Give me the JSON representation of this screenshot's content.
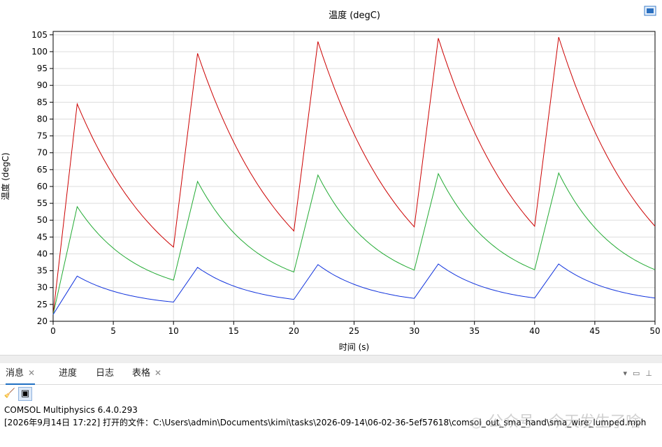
{
  "plot": {
    "title": "温度 (degC)",
    "toolbar_icon": "export-image-icon"
  },
  "chart_data": {
    "type": "line",
    "title": "温度 (degC)",
    "xlabel": "时间 (s)",
    "ylabel": "温度 (degC)",
    "xlim": [
      0,
      50
    ],
    "ylim": [
      20,
      106
    ],
    "x_ticks": [
      0,
      5,
      10,
      15,
      20,
      25,
      30,
      35,
      40,
      45,
      50
    ],
    "y_ticks": [
      20,
      25,
      30,
      35,
      40,
      45,
      50,
      55,
      60,
      65,
      70,
      75,
      80,
      85,
      90,
      95,
      100,
      105
    ],
    "grid": true,
    "legend": "none",
    "series": [
      {
        "color": "#cc0000",
        "points": [
          [
            0,
            22
          ],
          [
            2,
            84.5
          ],
          [
            10,
            42
          ],
          [
            12,
            99.5
          ],
          [
            20,
            46.8
          ],
          [
            22,
            103
          ],
          [
            30,
            48
          ],
          [
            32,
            104
          ],
          [
            40,
            48.2
          ],
          [
            42,
            104.3
          ],
          [
            50,
            48.2
          ]
        ],
        "decay_rate": 0.13
      },
      {
        "color": "#22aa33",
        "points": [
          [
            0,
            22
          ],
          [
            2,
            54
          ],
          [
            10,
            32.2
          ],
          [
            12,
            61.5
          ],
          [
            20,
            34.6
          ],
          [
            22,
            63.4
          ],
          [
            30,
            35.2
          ],
          [
            32,
            63.8
          ],
          [
            40,
            35.3
          ],
          [
            42,
            64
          ],
          [
            50,
            35.3
          ]
        ],
        "decay_rate": 0.2
      },
      {
        "color": "#1133dd",
        "points": [
          [
            0,
            22
          ],
          [
            2,
            33.4
          ],
          [
            10,
            25.7
          ],
          [
            12,
            36
          ],
          [
            20,
            26.5
          ],
          [
            22,
            36.8
          ],
          [
            30,
            26.8
          ],
          [
            32,
            37
          ],
          [
            40,
            26.9
          ],
          [
            42,
            37
          ],
          [
            50,
            26.9
          ]
        ],
        "decay_rate": 0.22
      }
    ]
  },
  "messages_panel": {
    "tabs": [
      {
        "label": "消息",
        "active": true,
        "closable": true
      },
      {
        "label": "进度",
        "active": false,
        "closable": false
      },
      {
        "label": "日志",
        "active": false,
        "closable": false
      },
      {
        "label": "表格",
        "active": false,
        "closable": true
      }
    ],
    "window_controls": [
      "chevron-down-icon",
      "maximize-icon",
      "pin-icon"
    ],
    "toolbar": [
      "clear-broom-icon",
      "log-window-icon"
    ],
    "lines": [
      "COMSOL Multiphysics 6.4.0.293",
      "[2026年9月14日 17:22] 打开的文件：C:\\Users\\admin\\Documents\\kimi\\tasks\\2026-09-14\\06-02-36-5ef57618\\comsol_out_sma_hand\\sma_wire_lumped.mph"
    ]
  },
  "watermark": {
    "text": "公众号 · 今天发生了啥"
  }
}
